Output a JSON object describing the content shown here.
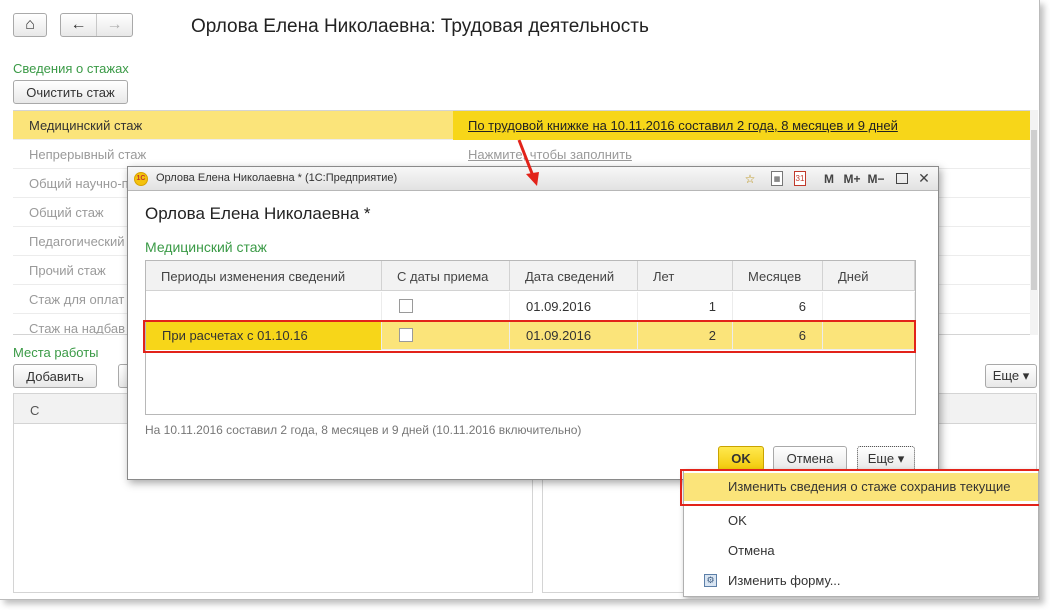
{
  "page": {
    "title": "Орлова Елена Николаевна: Трудовая деятельность",
    "home_icon": "home-icon",
    "back_icon": "arrow-left-icon",
    "forward_icon": "arrow-right-icon",
    "home_glyph": "⌂",
    "back_glyph": "←",
    "forward_glyph": "→"
  },
  "experience": {
    "section_label": "Сведения о стажах",
    "clear_button": "Очистить стаж",
    "rows": [
      {
        "name": "Медицинский стаж",
        "value": "По трудовой книжке на 10.11.2016 составил 2 года, 8 месяцев и 9 дней",
        "selected": true
      },
      {
        "name": "Непрерывный стаж",
        "value": "Нажмите, чтобы заполнить",
        "selected": false
      },
      {
        "name": "Общий научно-п",
        "value": "",
        "selected": false
      },
      {
        "name": "Общий стаж",
        "value": "",
        "selected": false
      },
      {
        "name": "Педагогический",
        "value": "",
        "selected": false
      },
      {
        "name": "Прочий стаж",
        "value": "",
        "selected": false
      },
      {
        "name": "Стаж для оплат",
        "value": "",
        "selected": false
      },
      {
        "name": "Стаж на надбав",
        "value": "",
        "selected": false
      }
    ]
  },
  "workplaces": {
    "section_label": "Места работы",
    "add_button": "Добавить",
    "more_button": "Еще ▾",
    "column_header": "С"
  },
  "modal": {
    "window_title": "Орлова Елена Николаевна * (1С:Предприятие)",
    "logo_text": "1С",
    "heading": "Орлова Елена Николаевна *",
    "subheading": "Медицинский стаж",
    "toolbar": {
      "favorite_glyph": "☆",
      "calc_glyph": "▦",
      "calendar_glyph": "31",
      "m_label": "M",
      "mplus_label": "M+",
      "mminus_label": "M−",
      "close_glyph": "✕"
    },
    "columns": [
      "Периоды изменения сведений",
      "С даты приема",
      "Дата сведений",
      "Лет",
      "Месяцев",
      "Дней"
    ],
    "rows": [
      {
        "period": "",
        "from_hire": false,
        "date": "01.09.2016",
        "years": "1",
        "months": "6",
        "days": ""
      },
      {
        "period": "При расчетах с  01.10.16",
        "from_hire": false,
        "date": "01.09.2016",
        "years": "2",
        "months": "6",
        "days": ""
      }
    ],
    "footer_note": "На 10.11.2016 составил 2 года, 8 месяцев и 9 дней (10.11.2016 включительно)",
    "ok_button": "OK",
    "cancel_button": "Отмена",
    "more_button": "Еще ▾"
  },
  "menu": {
    "items": [
      {
        "label": "Изменить сведения о стаже сохранив текущие",
        "selected": true
      },
      {
        "label": "OK",
        "selected": false
      },
      {
        "label": "Отмена",
        "selected": false
      },
      {
        "label": "Изменить форму...",
        "selected": false,
        "icon": "form-settings-icon"
      }
    ]
  },
  "colors": {
    "accent_green": "#3a9a46",
    "selection_yellow": "#fbe47a",
    "selection_strong": "#f7d619",
    "highlight_red": "#e2231a"
  }
}
